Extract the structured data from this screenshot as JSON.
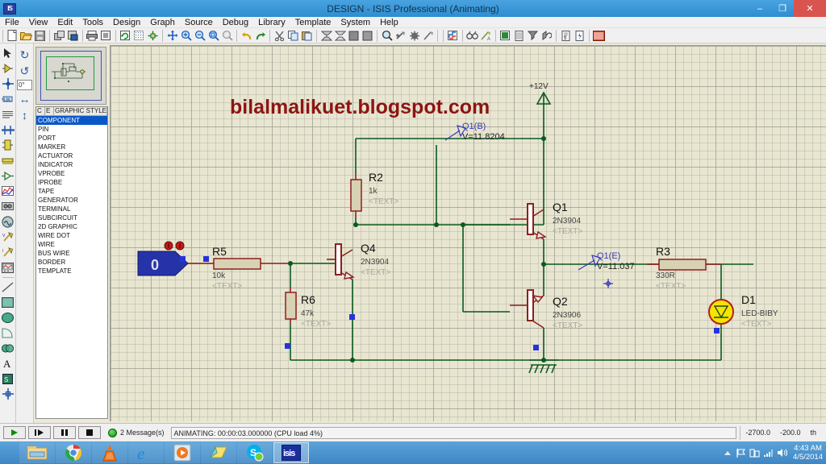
{
  "window": {
    "title": "DESIGN - ISIS Professional (Animating)",
    "app_icon": "isis-icon",
    "minimize": "–",
    "maximize": "❐",
    "close": "✕"
  },
  "menu": {
    "items": [
      {
        "label": "File"
      },
      {
        "label": "View"
      },
      {
        "label": "Edit"
      },
      {
        "label": "Tools"
      },
      {
        "label": "Design"
      },
      {
        "label": "Graph"
      },
      {
        "label": "Source"
      },
      {
        "label": "Debug"
      },
      {
        "label": "Library"
      },
      {
        "label": "Template"
      },
      {
        "label": "System"
      },
      {
        "label": "Help"
      }
    ]
  },
  "toolbar": {
    "groups": [
      [
        "new-file-icon",
        "open-file-icon",
        "save-file-icon"
      ],
      [
        "import-section-icon",
        "export-section-icon"
      ],
      [
        "print-icon",
        "print-area-icon"
      ],
      [
        "refresh-display-icon",
        "toggle-grid-icon",
        "toggle-origin-icon"
      ],
      [
        "pan-icon",
        "zoom-in-icon",
        "zoom-out-icon",
        "zoom-area-icon",
        "zoom-all-icon"
      ],
      [
        "undo-icon",
        "redo-icon"
      ],
      [
        "cut-icon",
        "copy-icon",
        "paste-icon"
      ],
      [
        "copy-block-icon",
        "move-block-icon",
        "rotate-block-icon",
        "delete-block-icon"
      ],
      [
        "pick-device-icon",
        "make-device-icon",
        "package-tool-icon",
        "decompose-icon"
      ],
      [
        "wire-autorouter-icon",
        "search-tag-icon",
        "property-assign-icon"
      ],
      [
        "design-explorer-icon",
        "new-sheet-icon",
        "remove-sheet-icon",
        "exit-sheet-icon"
      ],
      [
        "bill-of-materials-icon",
        "electrical-rules-icon"
      ],
      [
        "netlist-ares-icon"
      ]
    ]
  },
  "vertical_toolbar": {
    "items": [
      {
        "name": "selection-mode-icon"
      },
      {
        "name": "component-mode-icon"
      },
      {
        "name": "junction-dot-mode-icon"
      },
      {
        "name": "wire-label-mode-icon"
      },
      {
        "name": "text-script-mode-icon"
      },
      {
        "name": "buses-mode-icon"
      },
      {
        "name": "subcircuit-mode-icon"
      },
      {
        "name": "terminals-mode-icon"
      },
      {
        "name": "device-pins-mode-icon"
      },
      {
        "name": "graph-mode-icon"
      },
      {
        "name": "tape-recorder-mode-icon"
      },
      {
        "name": "generator-mode-icon"
      },
      {
        "name": "voltage-probe-mode-icon"
      },
      {
        "name": "current-probe-mode-icon"
      },
      {
        "name": "virtual-instrument-mode-icon"
      },
      {
        "name": "line-tool-icon"
      },
      {
        "name": "box-tool-icon"
      },
      {
        "name": "circle-tool-icon"
      },
      {
        "name": "arc-tool-icon"
      },
      {
        "name": "closed-path-tool-icon"
      },
      {
        "name": "text-tool-icon"
      },
      {
        "name": "symbol-tool-icon"
      },
      {
        "name": "marker-tool-icon"
      }
    ]
  },
  "orientation": {
    "rotate_cw_icon": "↻",
    "rotate_ccw_icon": "↺",
    "angle_value": "0°",
    "mirror_x_icon": "↔",
    "mirror_y_icon": "↕"
  },
  "styles_panel": {
    "headers": [
      "C",
      "E",
      "GRAPHIC STYLES"
    ],
    "selected": "COMPONENT",
    "items": [
      "COMPONENT",
      "PIN",
      "PORT",
      "MARKER",
      "ACTUATOR",
      "INDICATOR",
      "VPROBE",
      "IPROBE",
      "TAPE",
      "GENERATOR",
      "TERMINAL",
      "SUBCIRCUIT",
      "2D GRAPHIC",
      "WIRE DOT",
      "WIRE",
      "BUS WIRE",
      "BORDER",
      "TEMPLATE"
    ]
  },
  "canvas": {
    "watermark": "bilalmalikuet.blogspot.com",
    "power_label": "+12V",
    "logic_state_value": "0",
    "components": [
      {
        "ref": "R2",
        "value": "1k",
        "text": "<TEXT>"
      },
      {
        "ref": "R5",
        "value": "10k",
        "text": "<TEXT>"
      },
      {
        "ref": "R6",
        "value": "47k",
        "text": "<TEXT>"
      },
      {
        "ref": "R3",
        "value": "330R",
        "text": "<TEXT>"
      },
      {
        "ref": "Q4",
        "value": "2N3904",
        "text": "<TEXT>"
      },
      {
        "ref": "Q1",
        "value": "2N3904",
        "text": "<TEXT>"
      },
      {
        "ref": "Q2",
        "value": "2N3906",
        "text": "<TEXT>"
      },
      {
        "ref": "D1",
        "value": "LED-BIBY",
        "text": "<TEXT>"
      }
    ],
    "probes": [
      {
        "label": "Q1(B)",
        "reading": "V=11.8204"
      },
      {
        "label": "Q1(E)",
        "reading": "V=11.037"
      }
    ],
    "colors": {
      "wire": "#0a5a1e",
      "body": "#8e1f1f",
      "background": "#e8e6d0",
      "led_on": "#f5e400"
    }
  },
  "status_bar": {
    "play_icon": "play-icon",
    "step_icon": "step-icon",
    "pause_icon": "pause-icon",
    "stop_icon": "stop-icon",
    "messages": "2 Message(s)",
    "animating": "ANIMATING: 00:00:03.000000 (CPU load 4%)",
    "coord_x": "-2700.0",
    "coord_y": "-200.0",
    "coord_units": "th"
  },
  "taskbar": {
    "items": [
      {
        "name": "file-explorer-icon"
      },
      {
        "name": "chrome-icon"
      },
      {
        "name": "vlc-icon"
      },
      {
        "name": "internet-explorer-icon"
      },
      {
        "name": "media-player-icon"
      },
      {
        "name": "sticky-notes-icon"
      },
      {
        "name": "skype-icon"
      },
      {
        "name": "isis-taskbar-icon"
      }
    ],
    "tray": {
      "show_hidden_icon": "▲",
      "flag_icon": "⚑",
      "action_center_icon": "⧉",
      "network_icon": "network-icon",
      "volume_icon": "🔊",
      "time": "4:43 AM",
      "date": "4/5/2014"
    }
  }
}
